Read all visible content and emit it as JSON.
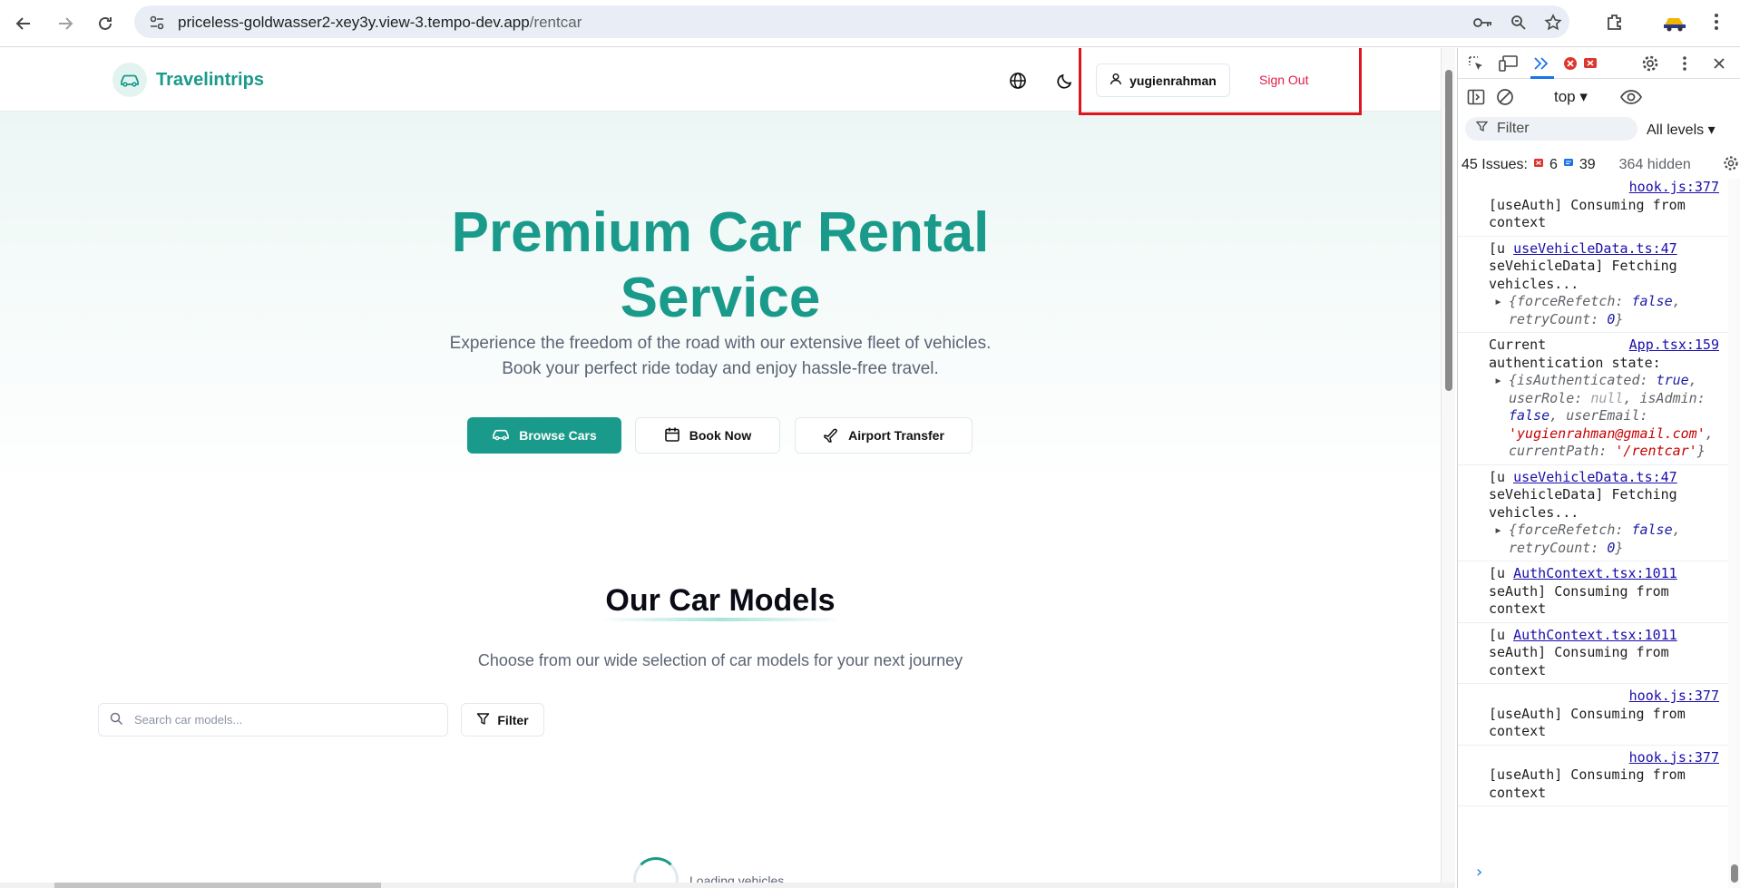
{
  "browser": {
    "url_host": "priceless-goldwasser2-xey3y.view-3.tempo-dev.app",
    "url_path": "/rentcar"
  },
  "site": {
    "brand": "Travelintrips",
    "user_label": "yugienrahman",
    "sign_out": "Sign Out"
  },
  "hero": {
    "title_line1": "Premium Car Rental",
    "title_line2": "Service",
    "subtitle_line1": "Experience the freedom of the road with our extensive fleet of vehicles.",
    "subtitle_line2": "Book your perfect ride today and enjoy hassle-free travel.",
    "buttons": {
      "browse": "Browse Cars",
      "book": "Book Now",
      "airport": "Airport Transfer"
    }
  },
  "models": {
    "title": "Our Car Models",
    "subtitle": "Choose from our wide selection of car models for your next journey",
    "search_placeholder": "Search car models...",
    "filter_label": "Filter",
    "loading": "Loading vehicles..."
  },
  "devtools": {
    "context": "top",
    "filter_placeholder": "Filter",
    "levels": "All levels",
    "issues_label": "45 Issues:",
    "issues_errors": "6",
    "issues_info": "39",
    "hidden": "364 hidden",
    "logs": [
      {
        "src": "hook.js:377",
        "text": "[useAuth] Consuming from context"
      },
      {
        "src": "useVehicleData.ts:47",
        "prefix": "[u",
        "text": "seVehicleData] Fetching vehicles...",
        "obj": "{forceRefetch: false, retryCount: 0}"
      },
      {
        "src": "App.tsx:159",
        "prefix": "Current",
        "text": "authentication state:",
        "obj": "{isAuthenticated: true, userRole: null, isAdmin: false, userEmail: 'yugienrahman@gmail.com', currentPath: '/rentcar'}"
      },
      {
        "src": "useVehicleData.ts:47",
        "prefix": "[u",
        "text": "seVehicleData] Fetching vehicles...",
        "obj": "{forceRefetch: false, retryCount: 0}"
      },
      {
        "src": "AuthContext.tsx:1011",
        "prefix": "[u",
        "text": "seAuth] Consuming from context"
      },
      {
        "src": "AuthContext.tsx:1011",
        "prefix": "[u",
        "text": "seAuth] Consuming from context"
      },
      {
        "src": "hook.js:377",
        "text": "[useAuth] Consuming from context"
      },
      {
        "src": "hook.js:377",
        "text": "[useAuth] Consuming from context"
      }
    ]
  },
  "colors": {
    "brand": "#1a9a8a",
    "danger": "#e11d48",
    "highlight": "#e0141e"
  }
}
